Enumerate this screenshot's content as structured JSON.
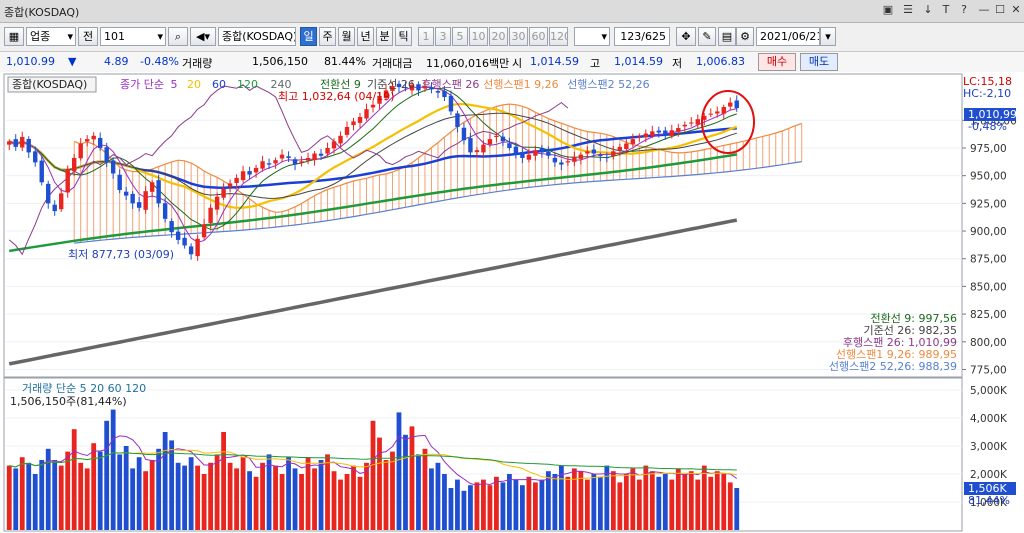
{
  "window": {
    "title": "종합(KOSDAQ)"
  },
  "toolbar": {
    "market": "업종",
    "prev_label": "전",
    "code": "101",
    "name": "종합(KOSDAQ)",
    "periods": [
      "일",
      "주",
      "월",
      "년",
      "분",
      "틱"
    ],
    "active_period": "일",
    "minutes": [
      "1",
      "3",
      "5",
      "10",
      "20",
      "30",
      "60",
      "120"
    ],
    "count": "123",
    "total": "/625",
    "date": "2021/06/21"
  },
  "info": {
    "price": "1,010.99",
    "arrow": "▼",
    "change": "4.89",
    "change_pct": "-0.48%",
    "volume_label": "거래량",
    "volume": "1,506,150",
    "volume_pct": "81.44%",
    "amount_label": "거래대금",
    "amount": "11,060,016백만",
    "open_label": "시",
    "open": "1,014.59",
    "high_label": "고",
    "high": "1,014.59",
    "low_label": "저",
    "low": "1,006.83",
    "buy": "매수",
    "sell": "매도"
  },
  "colors": {
    "up": "#e8261f",
    "down": "#1f4fd0",
    "ma5": "#9b2bc4",
    "ma20": "#f5c000",
    "ma60": "#1a3fd8",
    "ma120": "#1f9a3a",
    "ma240": "#666666",
    "conv": "#1a6b1a",
    "base": "#444444",
    "lag": "#8b3a8b",
    "lead1": "#f08a40",
    "lead2": "#5a80d0"
  },
  "chart_data": [
    {
      "type": "candlestick",
      "title": "종합(KOSDAQ)",
      "ylim": [
        770,
        1040
      ],
      "y_ticks": [
        775,
        800,
        825,
        850,
        875,
        900,
        925,
        950,
        975,
        1000
      ],
      "y_tick_labels": [
        "775,00",
        "800,00",
        "825,00",
        "850,00",
        "875,00",
        "900,00",
        "925,00",
        "950,00",
        "975,00",
        "1,000,00"
      ],
      "legend_ma": [
        {
          "label": "종가 단순",
          "color": "#9b2bc4"
        },
        {
          "label": "5",
          "color": "#9b2bc4"
        },
        {
          "label": "20",
          "color": "#f5c000"
        },
        {
          "label": "60",
          "color": "#1a3fd8"
        },
        {
          "label": "120",
          "color": "#1f9a3a"
        },
        {
          "label": "240",
          "color": "#666666"
        }
      ],
      "legend_ichimoku": [
        {
          "label": "전환선 9",
          "color": "#1a6b1a"
        },
        {
          "label": "기준선 26",
          "color": "#444444"
        },
        {
          "label": "후행스팬 26",
          "color": "#8b3a8b"
        },
        {
          "label": "선행스팬1 9,26",
          "color": "#f08a40"
        },
        {
          "label": "선행스팬2 52,26",
          "color": "#5a80d0"
        }
      ],
      "high_note": "최고 1,032,64 (04/19)",
      "low_note": "최저 877,73 (03/09)",
      "last_price_label": "1,010,99",
      "last_pct_label": "-0,48%",
      "lc_label": "LC:15,18",
      "hc_label": "HC:-2,10",
      "ichimoku_values": [
        {
          "label": "전환선 9: 997,56",
          "color": "#1a6b1a"
        },
        {
          "label": "기준선 26: 982,35",
          "color": "#444444"
        },
        {
          "label": "후행스팬 26: 1,010,99",
          "color": "#8b3a8b"
        },
        {
          "label": "선행스팬1 9,26: 989,95",
          "color": "#f08a40"
        },
        {
          "label": "선행스팬2 52,26: 988,39",
          "color": "#5a80d0"
        }
      ],
      "close": [
        981,
        976,
        985,
        971,
        962,
        944,
        925,
        918,
        934,
        956,
        966,
        979,
        983,
        986,
        975,
        962,
        952,
        937,
        932,
        925,
        921,
        936,
        944,
        925,
        911,
        899,
        892,
        887,
        879,
        893,
        906,
        921,
        931,
        938,
        943,
        948,
        954,
        951,
        957,
        963,
        960,
        964,
        969,
        966,
        960,
        963,
        966,
        970,
        968,
        975,
        981,
        986,
        994,
        999,
        1003,
        1010,
        1014,
        1022,
        1027,
        1031,
        1030,
        1029,
        1032,
        1027,
        1031,
        1028,
        1025,
        1021,
        1008,
        994,
        982,
        971,
        973,
        978,
        983,
        986,
        981,
        975,
        970,
        966,
        969,
        973,
        971,
        968,
        962,
        960,
        963,
        967,
        969,
        972,
        970,
        968,
        966,
        972,
        976,
        979,
        983,
        985,
        988,
        990,
        989,
        987,
        991,
        993,
        996,
        998,
        1001,
        1004,
        1006,
        1008,
        1012,
        1016,
        1011
      ],
      "volume_ylim": [
        0,
        5000000
      ],
      "volume_tick_labels": [
        "5,000K",
        "4,000K",
        "3,000K",
        "2,000K",
        "1,000K"
      ],
      "volume_ticks": [
        5000000,
        4000000,
        3000000,
        2000000,
        1000000
      ],
      "volume_title": "거래량 단순 5 20 60 120",
      "volume_note": "1,506,150주(81,44%)",
      "volume_last_label": "1,506K",
      "volume_last_pct": "81,44%",
      "volume": [
        2300,
        2200,
        2600,
        2400,
        2000,
        2500,
        2900,
        2500,
        2300,
        2800,
        3600,
        2400,
        2200,
        3100,
        2800,
        3900,
        4300,
        2700,
        3000,
        2200,
        2600,
        2100,
        2500,
        2900,
        3500,
        3200,
        2400,
        2300,
        2600,
        2300,
        2000,
        2400,
        2700,
        3500,
        2400,
        2200,
        2600,
        2100,
        1900,
        2400,
        2700,
        2300,
        2000,
        2600,
        2200,
        2000,
        2600,
        2200,
        2500,
        2700,
        2100,
        1800,
        2000,
        2300,
        1900,
        2400,
        3900,
        3300,
        2500,
        2800,
        4200,
        3400,
        3700,
        2700,
        2900,
        2200,
        2400,
        2000,
        1500,
        1800,
        1400,
        1600,
        1700,
        1800,
        1600,
        1900,
        1700,
        2000,
        1800,
        1600,
        1900,
        1700,
        1800,
        2100,
        2000,
        2300,
        1900,
        2200,
        2100,
        1800,
        2000,
        1900,
        2300,
        2100,
        1700,
        2000,
        2200,
        1800,
        2300,
        2100,
        1900,
        2000,
        1800,
        2200,
        2000,
        2100,
        1800,
        2300,
        1900,
        2100,
        2000,
        1700,
        1500
      ]
    }
  ]
}
